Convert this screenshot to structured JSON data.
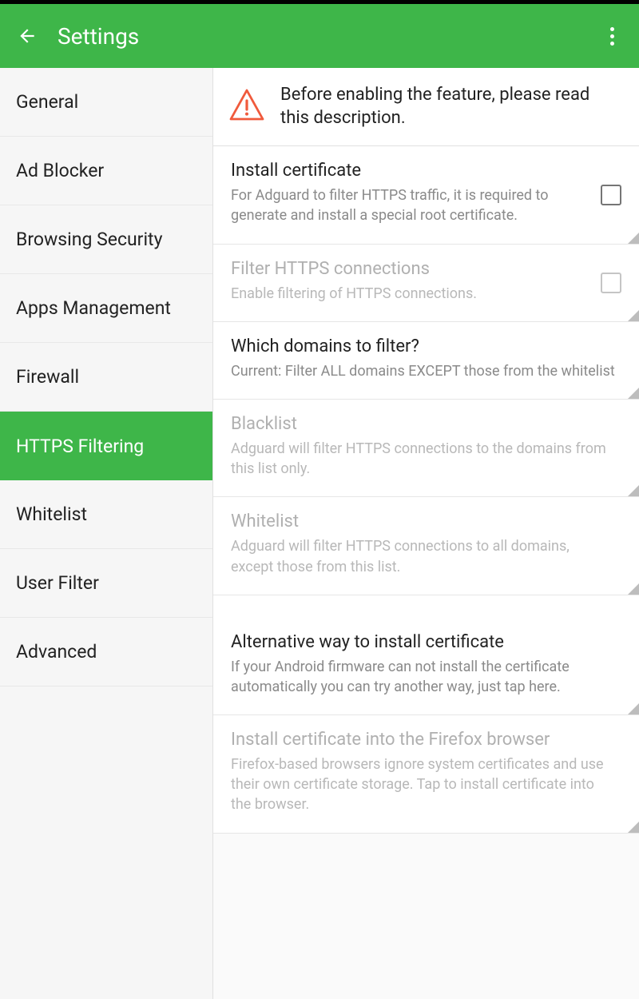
{
  "appbar": {
    "title": "Settings"
  },
  "sidebar": {
    "items": [
      {
        "label": "General"
      },
      {
        "label": "Ad Blocker"
      },
      {
        "label": "Browsing Security"
      },
      {
        "label": "Apps Management"
      },
      {
        "label": "Firewall"
      },
      {
        "label": "HTTPS Filtering"
      },
      {
        "label": "Whitelist"
      },
      {
        "label": "User Filter"
      },
      {
        "label": "Advanced"
      }
    ],
    "active_index": 5
  },
  "banner": {
    "text": "Before enabling the feature, please read this description."
  },
  "settings": [
    {
      "title": "Install certificate",
      "desc": "For Adguard to filter HTTPS traffic, it is required to generate and install a special root certificate.",
      "checkbox": true,
      "checked": false,
      "disabled": false
    },
    {
      "title": "Filter HTTPS connections",
      "desc": "Enable filtering of HTTPS connections.",
      "checkbox": true,
      "checked": false,
      "disabled": true
    },
    {
      "title": "Which domains to filter?",
      "desc": "Current: Filter ALL domains EXCEPT those from the whitelist",
      "checkbox": false,
      "disabled": false
    },
    {
      "title": "Blacklist",
      "desc": "Adguard will filter HTTPS connections to the domains from this list only.",
      "checkbox": false,
      "disabled": true
    },
    {
      "title": "Whitelist",
      "desc": "Adguard will filter HTTPS connections to all domains, except those from this list.",
      "checkbox": false,
      "disabled": true
    },
    {
      "title": "Alternative way to install certificate",
      "desc": "If your Android firmware can not install the certificate automatically you can try another way, just tap here.",
      "checkbox": false,
      "disabled": false
    },
    {
      "title": "Install certificate into the Firefox browser",
      "desc": "Firefox-based browsers ignore system certificates and use their own certificate storage. Tap to install certificate into the browser.",
      "checkbox": false,
      "disabled": true
    }
  ]
}
